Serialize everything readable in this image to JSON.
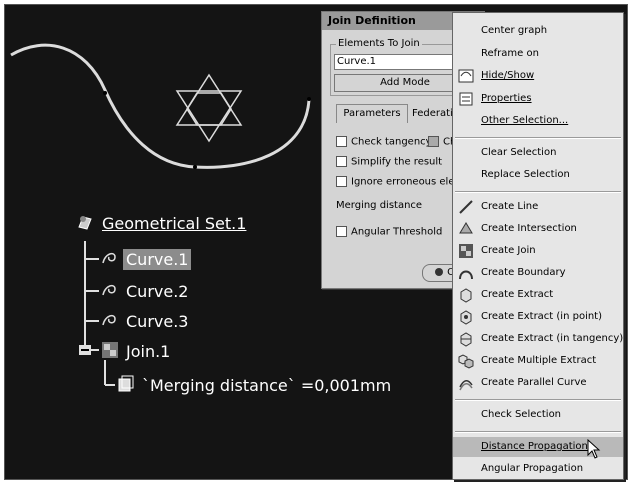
{
  "dialog": {
    "title": "Join Definition",
    "elements_group_label": "Elements To Join",
    "selected_element": "Curve.1",
    "add_mode_label": "Add Mode",
    "tab_parameters": "Parameters",
    "tab_federation": "Federatio",
    "check_tangency": "Check tangency",
    "check_connexity_partial": "Ch",
    "simplify": "Simplify the result",
    "ignore_erroneous": "Ignore erroneous eleme",
    "merging_distance": "Merging distance",
    "angular_threshold": "Angular Threshold",
    "ok_partial": "O"
  },
  "tree": {
    "root": "Geometrical Set.1",
    "items": [
      "Curve.1",
      "Curve.2",
      "Curve.3"
    ],
    "join": "Join.1",
    "parameter": "`Merging distance` =0,001mm"
  },
  "menu": {
    "items": [
      {
        "label": "Center graph",
        "icon": ""
      },
      {
        "label": "Reframe on",
        "icon": ""
      },
      {
        "label": "Hide/Show",
        "icon": "hide-show-icon"
      },
      {
        "label": "Properties",
        "icon": "properties-icon"
      },
      {
        "label": "Other Selection...",
        "icon": ""
      },
      {
        "label": "Clear Selection",
        "icon": ""
      },
      {
        "label": "Replace Selection",
        "icon": ""
      },
      {
        "label": "Create Line",
        "icon": "line-icon"
      },
      {
        "label": "Create Intersection",
        "icon": "intersection-icon"
      },
      {
        "label": "Create Join",
        "icon": "join-icon"
      },
      {
        "label": "Create Boundary",
        "icon": "boundary-icon"
      },
      {
        "label": "Create Extract",
        "icon": "extract-icon"
      },
      {
        "label": "Create Extract (in point)",
        "icon": "extract-point-icon"
      },
      {
        "label": "Create Extract (in tangency)",
        "icon": "extract-tangency-icon"
      },
      {
        "label": "Create Multiple Extract",
        "icon": "multiple-extract-icon"
      },
      {
        "label": "Create Parallel Curve",
        "icon": "parallel-curve-icon"
      },
      {
        "label": "Check Selection",
        "icon": ""
      },
      {
        "label": "Distance Propagation",
        "icon": ""
      },
      {
        "label": "Angular Propagation",
        "icon": ""
      }
    ]
  }
}
